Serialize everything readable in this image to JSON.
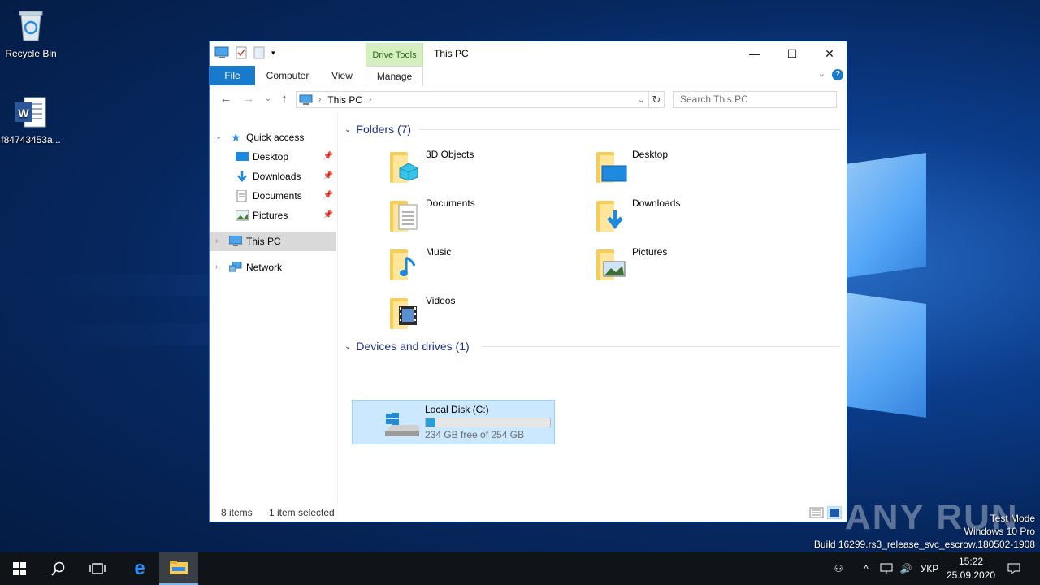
{
  "desktop": {
    "icons": [
      {
        "label": "Recycle Bin",
        "icon": "recycle-bin-icon"
      },
      {
        "label": "f84743453a...",
        "icon": "word-document-icon"
      }
    ]
  },
  "window": {
    "title": "This PC",
    "context_tab_group": "Drive Tools",
    "ribbon_tabs": [
      "File",
      "Computer",
      "View",
      "Manage"
    ],
    "controls": {
      "minimize": "—",
      "maximize": "☐",
      "close": "✕"
    }
  },
  "navigation": {
    "address": [
      "This PC"
    ],
    "search_placeholder": "Search This PC"
  },
  "nav_pane": {
    "quick_access": "Quick access",
    "pinned": [
      "Desktop",
      "Downloads",
      "Documents",
      "Pictures"
    ],
    "this_pc": "This PC",
    "network": "Network"
  },
  "content": {
    "folders_header": "Folders (7)",
    "folders": [
      "3D Objects",
      "Desktop",
      "Documents",
      "Downloads",
      "Music",
      "Pictures",
      "Videos"
    ],
    "drives_header": "Devices and drives (1)",
    "drive": {
      "name": "Local Disk (C:)",
      "free_text": "234 GB free of 254 GB",
      "used_fraction": 0.079
    }
  },
  "status": {
    "items": "8 items",
    "selected": "1 item selected"
  },
  "taskbar": {
    "language": "УКР",
    "time": "15:22",
    "date": "25.09.2020"
  },
  "watermark": {
    "brand": "ANY RUN",
    "line1": "Test Mode",
    "line2": "Windows 10 Pro",
    "line3": "Build 16299.rs3_release_svc_escrow.180502-1908"
  },
  "colors": {
    "accent": "#1979ca",
    "selection": "#cce8ff",
    "drive_tools": "#d6efc1"
  }
}
